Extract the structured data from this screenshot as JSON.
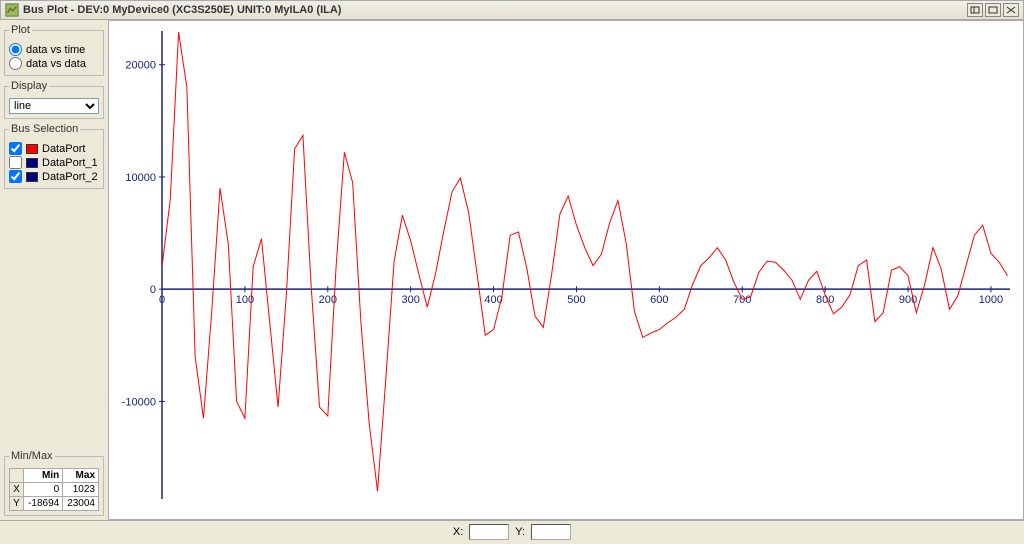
{
  "window": {
    "title": "Bus Plot - DEV:0 MyDevice0 (XC3S250E) UNIT:0 MyILA0 (ILA)"
  },
  "panels": {
    "plot": {
      "legend": "Plot",
      "opt_time": "data vs time",
      "opt_data": "data vs data"
    },
    "display": {
      "legend": "Display",
      "selected": "line"
    },
    "bus": {
      "legend": "Bus Selection",
      "items": [
        {
          "label": "DataPort",
          "color": "#ff0000",
          "checked": true
        },
        {
          "label": "DataPort_1",
          "color": "#000080",
          "checked": false
        },
        {
          "label": "DataPort_2",
          "color": "#000080",
          "checked": true
        }
      ]
    },
    "minmax": {
      "legend": "Min/Max",
      "head_min": "Min",
      "head_max": "Max",
      "rows": [
        {
          "axis": "X",
          "min": "0",
          "max": "1023"
        },
        {
          "axis": "Y",
          "min": "-18694",
          "max": "23004"
        }
      ]
    }
  },
  "status": {
    "x_label": "X:",
    "y_label": "Y:",
    "x_val": "",
    "y_val": ""
  },
  "chart_data": {
    "type": "line",
    "xlabel": "",
    "ylabel": "",
    "xlim": [
      0,
      1023
    ],
    "ylim": [
      -18694,
      23004
    ],
    "x_ticks": [
      0,
      100,
      200,
      300,
      400,
      500,
      600,
      700,
      800,
      900,
      1000
    ],
    "y_ticks": [
      -10000,
      0,
      10000,
      20000
    ],
    "series": [
      {
        "name": "DataPort",
        "color": "#ff0000"
      }
    ],
    "x": [
      0,
      10,
      20,
      30,
      40,
      50,
      60,
      70,
      80,
      90,
      100,
      110,
      120,
      130,
      140,
      150,
      160,
      170,
      180,
      190,
      200,
      210,
      220,
      230,
      240,
      250,
      260,
      270,
      280,
      290,
      300,
      310,
      320,
      330,
      340,
      350,
      360,
      370,
      380,
      390,
      400,
      410,
      420,
      430,
      440,
      450,
      460,
      470,
      480,
      490,
      500,
      510,
      520,
      530,
      540,
      550,
      560,
      570,
      580,
      590,
      600,
      610,
      620,
      630,
      640,
      650,
      660,
      670,
      680,
      690,
      700,
      710,
      720,
      730,
      740,
      750,
      760,
      770,
      780,
      790,
      800,
      810,
      820,
      830,
      840,
      850,
      860,
      870,
      880,
      890,
      900,
      910,
      920,
      930,
      940,
      950,
      960,
      970,
      980,
      990,
      1000,
      1010,
      1020
    ],
    "y": [
      2000,
      8000,
      22900,
      18000,
      -6000,
      -11500,
      -2000,
      9000,
      4000,
      -10000,
      -11500,
      2000,
      4500,
      -3000,
      -10500,
      -500,
      12500,
      13700,
      200,
      -10500,
      -11300,
      2000,
      12200,
      9500,
      -3000,
      -12000,
      -18000,
      -8000,
      2500,
      6600,
      4300,
      1300,
      -1600,
      1400,
      5200,
      8700,
      9900,
      6800,
      1400,
      -4100,
      -3600,
      -700,
      4800,
      5100,
      1900,
      -2400,
      -3400,
      1300,
      6700,
      8300,
      5700,
      3700,
      2100,
      3100,
      5900,
      7900,
      4100,
      -2000,
      -4300,
      -3900,
      -3600,
      -3000,
      -2500,
      -1800,
      400,
      2100,
      2800,
      3700,
      2600,
      600,
      -900,
      -700,
      1500,
      2500,
      2400,
      1700,
      800,
      -900,
      800,
      1600,
      -500,
      -2200,
      -1600,
      -500,
      2100,
      2600,
      -2900,
      -2100,
      1700,
      2000,
      1200,
      -2100,
      400,
      3700,
      1800,
      -1800,
      -600,
      2100,
      4800,
      5700,
      3200,
      2400,
      1200
    ]
  }
}
